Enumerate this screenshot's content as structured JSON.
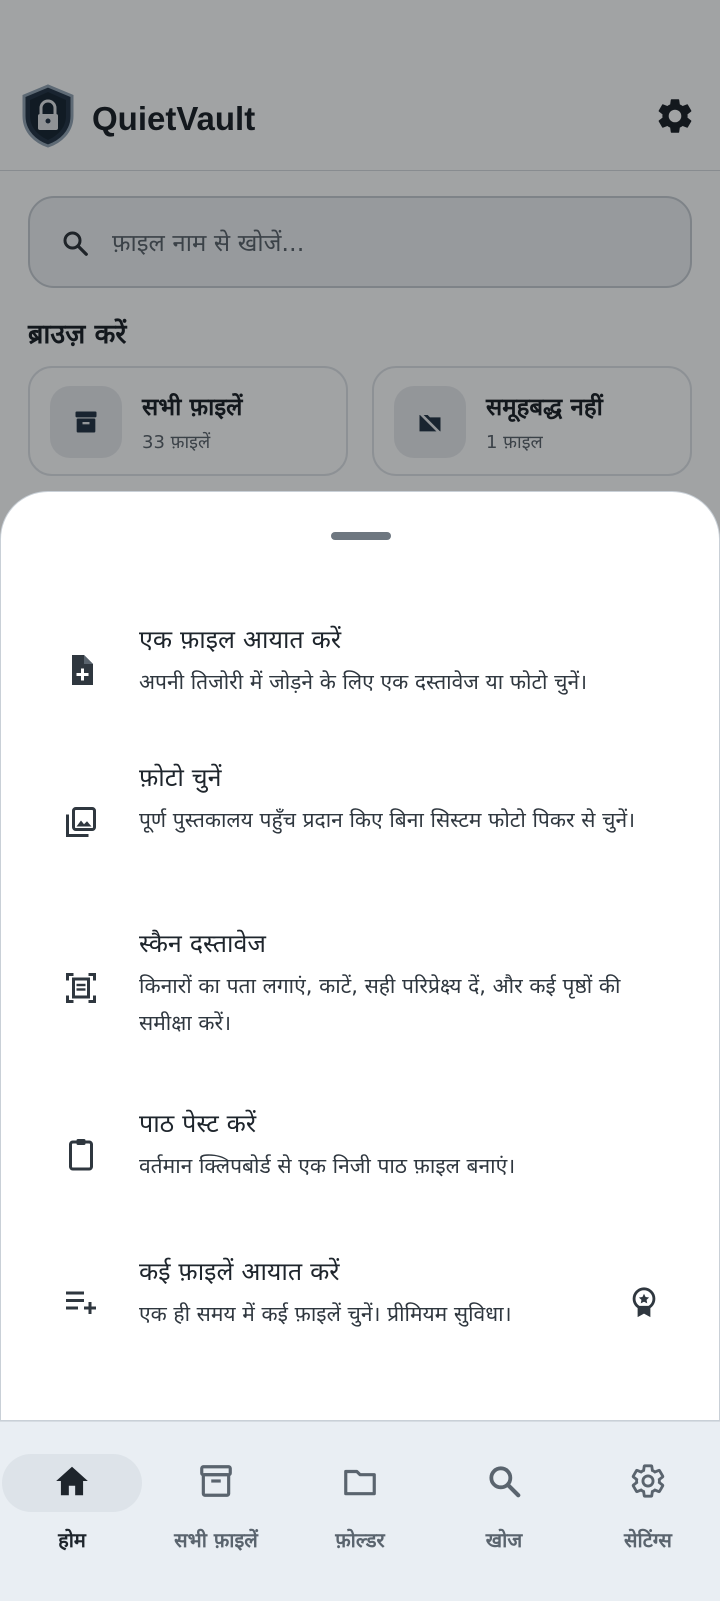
{
  "app": {
    "title": "QuietVault"
  },
  "search": {
    "placeholder": "फ़ाइल नाम से खोजें..."
  },
  "browse": {
    "title": "ब्राउज़ करें",
    "cards": [
      {
        "title": "सभी फ़ाइलें",
        "subtitle": "33 फ़ाइलें",
        "icon": "archive-icon"
      },
      {
        "title": "समूहबद्ध नहीं",
        "subtitle": "1 फ़ाइल",
        "icon": "folder-off-icon"
      }
    ]
  },
  "sheet": {
    "options": [
      {
        "title": "एक फ़ाइल आयात करें",
        "desc": "अपनी तिजोरी में जोड़ने के लिए एक दस्तावेज या फोटो चुनें।",
        "icon": "file-add-icon"
      },
      {
        "title": "फ़ोटो चुनें",
        "desc": "पूर्ण पुस्तकालय पहुँच प्रदान किए बिना सिस्टम फोटो पिकर से चुनें।",
        "icon": "photo-library-icon"
      },
      {
        "title": "स्कैन दस्तावेज",
        "desc": "किनारों का पता लगाएं, काटें, सही परिप्रेक्ष्य दें, और कई पृष्ठों की समीक्षा करें।",
        "icon": "document-scanner-icon"
      },
      {
        "title": "पाठ पेस्ट करें",
        "desc": "वर्तमान क्लिपबोर्ड से एक निजी पाठ फ़ाइल बनाएं।",
        "icon": "clipboard-icon"
      },
      {
        "title": "कई फ़ाइलें आयात करें",
        "desc": "एक ही समय में कई फ़ाइलें चुनें। प्रीमियम सुविधा।",
        "icon": "playlist-add-icon",
        "badge": "premium-badge-icon"
      }
    ]
  },
  "nav": {
    "items": [
      {
        "label": "होम",
        "icon": "home-icon",
        "active": true
      },
      {
        "label": "सभी फ़ाइलें",
        "icon": "archive-icon"
      },
      {
        "label": "फ़ोल्डर",
        "icon": "folder-icon"
      },
      {
        "label": "खोज",
        "icon": "search-icon"
      },
      {
        "label": "सेटिंग्स",
        "icon": "settings-icon"
      }
    ]
  },
  "colors": {
    "scrim": "#00000057",
    "sheet": "#ffffff",
    "nav_bg": "#e9eef3",
    "text": "#1e252c",
    "muted": "#5a646e"
  }
}
